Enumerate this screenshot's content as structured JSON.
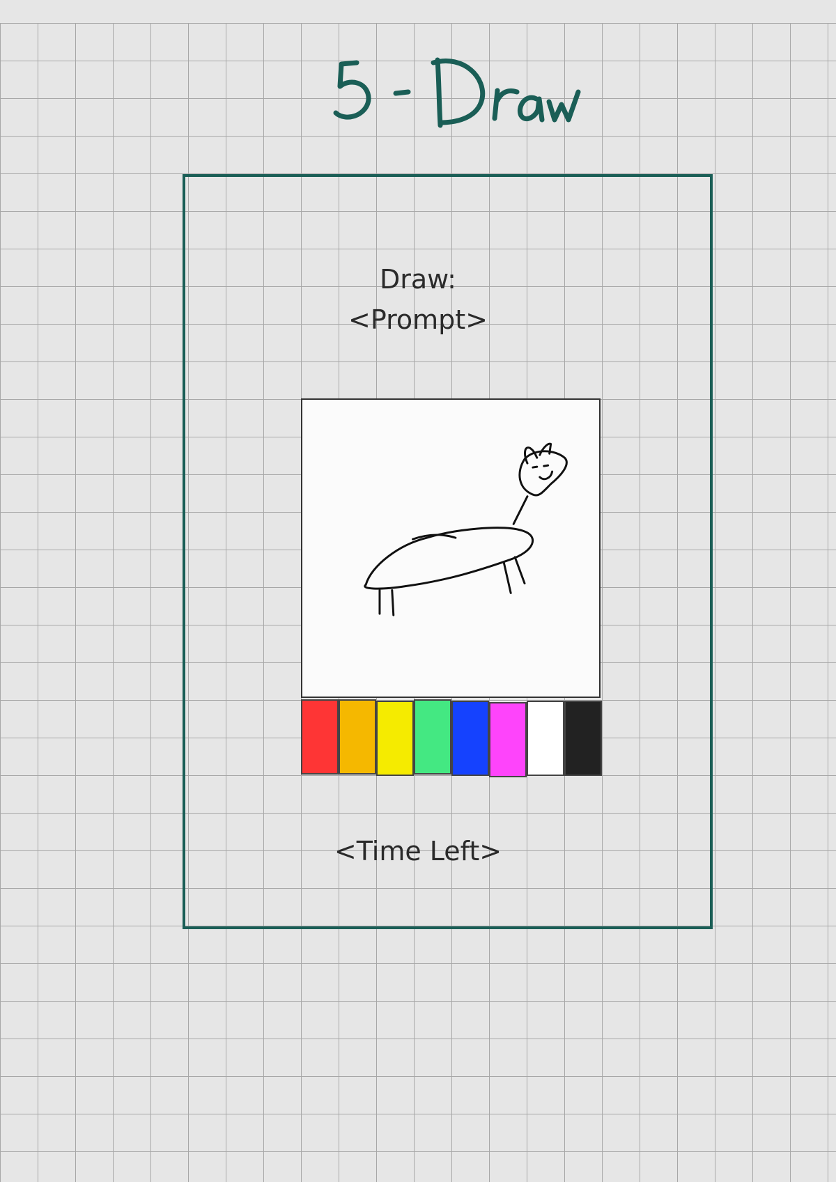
{
  "title": "5 - Draw",
  "prompt": {
    "line1": "Draw:",
    "line2": "<Prompt>"
  },
  "timer": "<Time Left>",
  "palette": [
    {
      "name": "red",
      "color": "#fe3535"
    },
    {
      "name": "orange",
      "color": "#f5b800"
    },
    {
      "name": "yellow",
      "color": "#f5eb00"
    },
    {
      "name": "green",
      "color": "#44e882"
    },
    {
      "name": "blue",
      "color": "#1542fe"
    },
    {
      "name": "magenta",
      "color": "#fe44fb"
    },
    {
      "name": "white",
      "color": "#ffffff"
    },
    {
      "name": "black",
      "color": "#222222"
    }
  ],
  "colors": {
    "accent": "#1a5e56",
    "background": "#e6e6e6",
    "grid": "#a7a7a7"
  }
}
